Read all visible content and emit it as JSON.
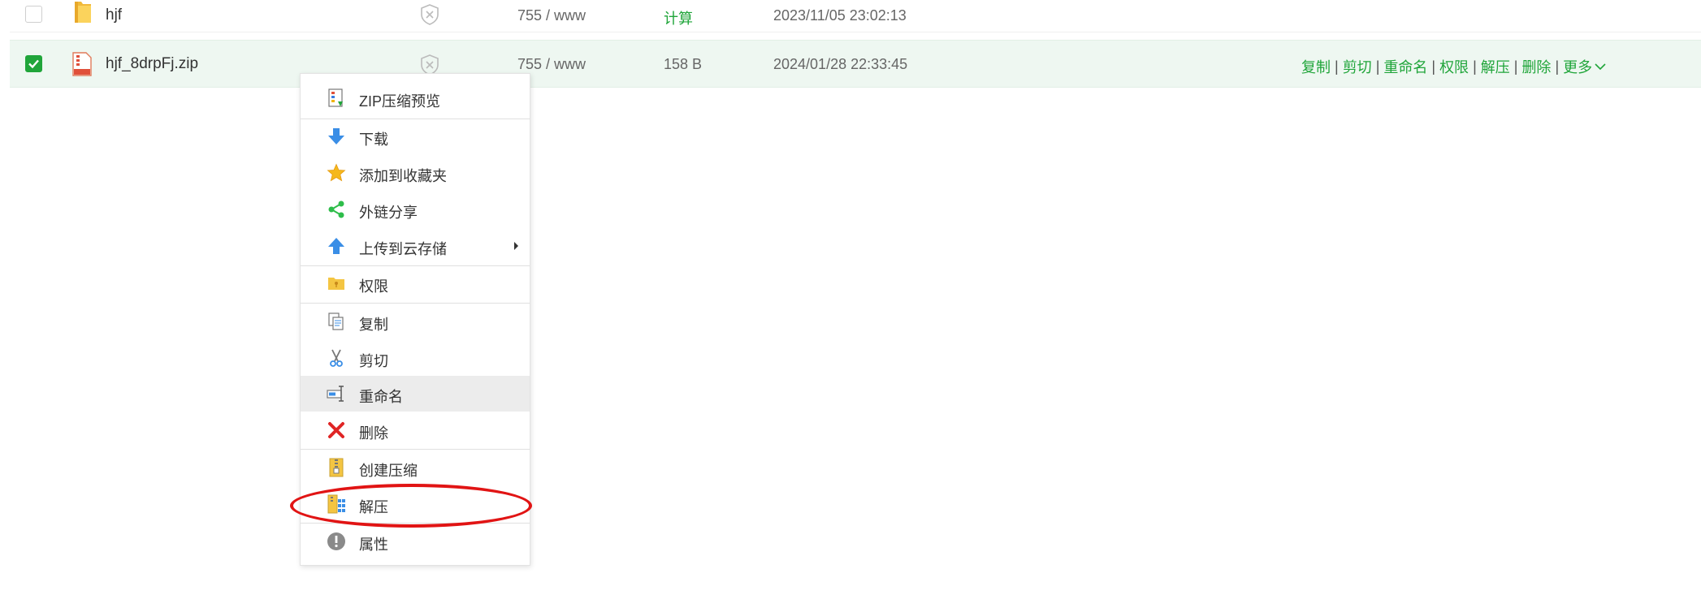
{
  "rows": [
    {
      "name": "hjf",
      "permission": "755 / www",
      "size": "计算",
      "mtime": "2023/11/05 23:02:13",
      "checked": false,
      "type": "folder-icon"
    },
    {
      "name": "hjf_8drpFj.zip",
      "permission": "755 / www",
      "size": "158 B",
      "mtime": "2024/01/28 22:33:45",
      "checked": true,
      "type": "zip-file-icon"
    }
  ],
  "row_ops": {
    "copy": "复制",
    "cut": "剪切",
    "rename": "重命名",
    "permission": "权限",
    "extract": "解压",
    "delete": "删除",
    "more": "更多",
    "separator": "|"
  },
  "context_menu": {
    "items": [
      {
        "label": "ZIP压缩预览",
        "icon": "zip-preview-icon"
      },
      {
        "label": "下载",
        "icon": "download-arrow-icon"
      },
      {
        "label": "添加到收藏夹",
        "icon": "star-icon"
      },
      {
        "label": "外链分享",
        "icon": "share-icon"
      },
      {
        "label": "上传到云存储",
        "icon": "upload-arrow-icon"
      },
      {
        "label": "权限",
        "icon": "permission-folder-icon"
      },
      {
        "label": "复制",
        "icon": "copy-icon"
      },
      {
        "label": "剪切",
        "icon": "scissors-icon"
      },
      {
        "label": "重命名",
        "icon": "rename-icon"
      },
      {
        "label": "删除",
        "icon": "delete-x-icon"
      },
      {
        "label": "创建压缩",
        "icon": "create-archive-icon"
      },
      {
        "label": "解压",
        "icon": "extract-archive-icon"
      },
      {
        "label": "属性",
        "icon": "properties-info-icon"
      }
    ],
    "highlighted": "重命名"
  },
  "colors": {
    "accent_green": "#20a53a",
    "annotation_red": "#e11414",
    "selected_row_bg": "#eef7f1",
    "menu_hover_bg": "#ececec"
  }
}
